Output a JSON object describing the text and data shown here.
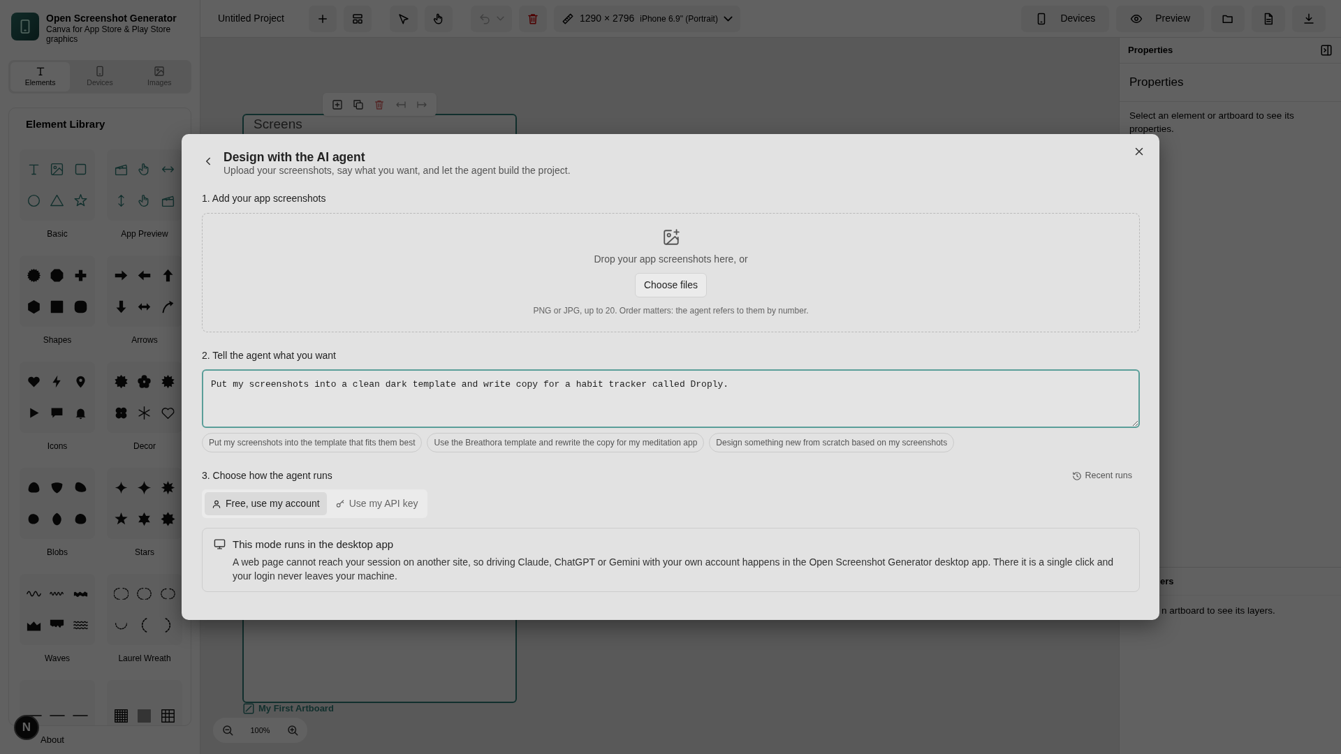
{
  "app": {
    "title": "Open Screenshot Generator",
    "subtitle": "Canva for App Store & Play Store graphics"
  },
  "sidebar_tabs": [
    {
      "kind": "elements",
      "label": "Elements",
      "selected": true
    },
    {
      "kind": "devices",
      "label": "Devices",
      "selected": false
    },
    {
      "kind": "images",
      "label": "Images",
      "selected": false
    }
  ],
  "library": {
    "title": "Element Library",
    "categories": [
      {
        "kind": "basic",
        "label": "Basic"
      },
      {
        "kind": "app-preview",
        "label": "App Preview"
      },
      {
        "kind": "shapes",
        "label": "Shapes"
      },
      {
        "kind": "arrows",
        "label": "Arrows"
      },
      {
        "kind": "icons",
        "label": "Icons"
      },
      {
        "kind": "decor",
        "label": "Decor"
      },
      {
        "kind": "blobs",
        "label": "Blobs"
      },
      {
        "kind": "stars",
        "label": "Stars"
      },
      {
        "kind": "waves",
        "label": "Waves"
      },
      {
        "kind": "laurel",
        "label": "Laurel Wreath"
      },
      {
        "kind": "lines"
      },
      {
        "kind": "grids"
      }
    ]
  },
  "about": "About",
  "badge": "N",
  "topbar": {
    "project": "Untitled Project",
    "undo": {
      "disabled": true
    },
    "size": "1290 × 2796",
    "device": "iPhone 6.9\" (Portrait)",
    "buttons": [
      {
        "kind": "devices",
        "label": "Devices"
      },
      {
        "kind": "preview",
        "label": "Preview"
      },
      {
        "kind": "open"
      },
      {
        "kind": "file"
      },
      {
        "kind": "export"
      }
    ]
  },
  "canvas": {
    "artboard_title": "Screens",
    "artboard_name": "My First Artboard",
    "zoom": "100%"
  },
  "properties": {
    "header": "Properties",
    "title": "Properties",
    "hint": "Select an element or artboard to see its properties."
  },
  "layers": {
    "header": "ers",
    "hint": "n artboard to see its layers."
  },
  "dialog": {
    "title": "Design with the AI agent",
    "subtitle": "Upload your screenshots, say what you want, and let the agent build the project.",
    "upload": {
      "label": "1. Add your app screenshots",
      "drop_text": "Drop your app screenshots here, or",
      "button": "Choose files",
      "hint": "PNG or JPG, up to 20. Order matters: the agent refers to them by number."
    },
    "prompt": {
      "label": "2. Tell the agent what you want",
      "value": "Put my screenshots into a clean dark template and write copy for a habit tracker called Droply.",
      "suggestions": [
        "Put my screenshots into the template that fits them best",
        "Use the Breathora template and rewrite the copy for my meditation app",
        "Design something new from scratch based on my screenshots"
      ]
    },
    "run": {
      "label": "3. Choose how the agent runs",
      "recent": "Recent runs",
      "modes": [
        {
          "kind": "account",
          "label": "Free, use my account",
          "selected": true
        },
        {
          "kind": "api-key",
          "label": "Use my API key",
          "selected": false
        }
      ],
      "notice": {
        "title": "This mode runs in the desktop app",
        "body": "A web page cannot reach your session on another site, so driving Claude, ChatGPT or Gemini with your own account happens in the Open Screenshot Generator desktop app. There it is a single click and your login never leaves your machine."
      }
    }
  }
}
